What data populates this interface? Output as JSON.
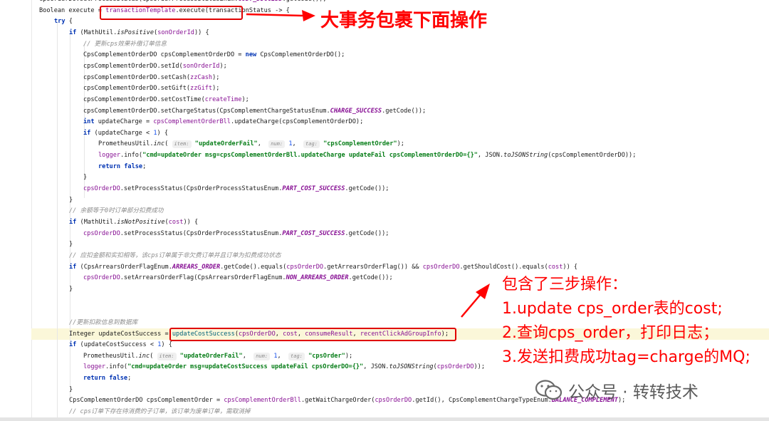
{
  "editor": {
    "lines": [
      {
        "indent": 0,
        "segments": [
          {
            "t": "cpsOrderDO.setProcessStatus(CpsOrderProcessStatusEnum."
          },
          {
            "t": "COST_SUCCESS",
            "c": "const"
          },
          {
            "t": ".getCode());"
          }
        ]
      },
      {
        "indent": 0,
        "segments": [
          {
            "t": "Boolean execute = "
          },
          {
            "t": "transactionTemplate",
            "c": "fld"
          },
          {
            "t": ".execute(transactionStatus -> {"
          }
        ]
      },
      {
        "indent": 1,
        "segments": [
          {
            "t": "try",
            "c": "kw"
          },
          {
            "t": " {"
          }
        ]
      },
      {
        "indent": 2,
        "segments": [
          {
            "t": "if",
            "c": "kw"
          },
          {
            "t": " (MathUtil."
          },
          {
            "t": "isPositive",
            "c": "ital"
          },
          {
            "t": "("
          },
          {
            "t": "sonOrderId",
            "c": "fld"
          },
          {
            "t": ")) {"
          }
        ]
      },
      {
        "indent": 3,
        "segments": [
          {
            "t": "// 更新cps效果补缴订单信息",
            "c": "cmt"
          }
        ]
      },
      {
        "indent": 3,
        "segments": [
          {
            "t": "CpsComplementOrderDO cpsComplementOrderDO = "
          },
          {
            "t": "new",
            "c": "kw"
          },
          {
            "t": " CpsComplementOrderDO();"
          }
        ]
      },
      {
        "indent": 3,
        "segments": [
          {
            "t": "cpsComplementOrderDO.setId("
          },
          {
            "t": "sonOrderId",
            "c": "fld"
          },
          {
            "t": ");"
          }
        ]
      },
      {
        "indent": 3,
        "segments": [
          {
            "t": "cpsComplementOrderDO.setCash("
          },
          {
            "t": "zzCash",
            "c": "fld"
          },
          {
            "t": ");"
          }
        ]
      },
      {
        "indent": 3,
        "segments": [
          {
            "t": "cpsComplementOrderDO.setGift("
          },
          {
            "t": "zzGift",
            "c": "fld"
          },
          {
            "t": ");"
          }
        ]
      },
      {
        "indent": 3,
        "segments": [
          {
            "t": "cpsComplementOrderDO.setCostTime("
          },
          {
            "t": "createTime",
            "c": "fld"
          },
          {
            "t": ");"
          }
        ]
      },
      {
        "indent": 3,
        "segments": [
          {
            "t": "cpsComplementOrderDO.setChargeStatus(CpsComplementChargeStatusEnum."
          },
          {
            "t": "CHARGE_SUCCESS",
            "c": "const"
          },
          {
            "t": ".getCode());"
          }
        ]
      },
      {
        "indent": 3,
        "segments": [
          {
            "t": "int",
            "c": "kw"
          },
          {
            "t": " updateCharge = "
          },
          {
            "t": "cpsComplementOrderBll",
            "c": "fld"
          },
          {
            "t": ".updateCharge(cpsComplementOrderDO);"
          }
        ]
      },
      {
        "indent": 3,
        "segments": [
          {
            "t": "if",
            "c": "kw"
          },
          {
            "t": " (updateCharge < "
          },
          {
            "t": "1",
            "c": "num"
          },
          {
            "t": ") {"
          }
        ]
      },
      {
        "indent": 4,
        "segments": [
          {
            "t": "PrometheusUtil."
          },
          {
            "t": "inc",
            "c": "ital"
          },
          {
            "t": "( "
          },
          {
            "t": "item:",
            "c": "hint"
          },
          {
            "t": " "
          },
          {
            "t": "\"updateOrderFail\"",
            "c": "str"
          },
          {
            "t": ",  "
          },
          {
            "t": "num:",
            "c": "hint"
          },
          {
            "t": " "
          },
          {
            "t": "1",
            "c": "num"
          },
          {
            "t": ",  "
          },
          {
            "t": "tag:",
            "c": "hint"
          },
          {
            "t": " "
          },
          {
            "t": "\"cpsComplementOrder\"",
            "c": "str"
          },
          {
            "t": ");"
          }
        ]
      },
      {
        "indent": 4,
        "segments": [
          {
            "t": "logger",
            "c": "fld"
          },
          {
            "t": ".info("
          },
          {
            "t": "\"cmd=updateOrder msg=cpsComplementOrderBll.updateCharge updateFail cpsComplementOrderDO={}\"",
            "c": "str"
          },
          {
            "t": ", JSON."
          },
          {
            "t": "toJSONString",
            "c": "ital"
          },
          {
            "t": "(cpsComplementOrderDO));"
          }
        ]
      },
      {
        "indent": 4,
        "segments": [
          {
            "t": "return false",
            "c": "kw"
          },
          {
            "t": ";"
          }
        ]
      },
      {
        "indent": 3,
        "segments": [
          {
            "t": "}"
          }
        ]
      },
      {
        "indent": 3,
        "segments": [
          {
            "t": "cpsOrderDO",
            "c": "fld"
          },
          {
            "t": ".setProcessStatus(CpsOrderProcessStatusEnum."
          },
          {
            "t": "PART_COST_SUCCESS",
            "c": "const"
          },
          {
            "t": ".getCode());"
          }
        ]
      },
      {
        "indent": 2,
        "segments": [
          {
            "t": "}"
          }
        ]
      },
      {
        "indent": 2,
        "segments": [
          {
            "t": "// 余额等于0时订单部分扣费成功",
            "c": "cmt"
          }
        ]
      },
      {
        "indent": 2,
        "segments": [
          {
            "t": "if",
            "c": "kw"
          },
          {
            "t": " (MathUtil."
          },
          {
            "t": "isNotPositive",
            "c": "ital"
          },
          {
            "t": "("
          },
          {
            "t": "cost",
            "c": "fld"
          },
          {
            "t": ")) {"
          }
        ]
      },
      {
        "indent": 3,
        "segments": [
          {
            "t": "cpsOrderDO",
            "c": "fld"
          },
          {
            "t": ".setProcessStatus(CpsOrderProcessStatusEnum."
          },
          {
            "t": "PART_COST_SUCCESS",
            "c": "const"
          },
          {
            "t": ".getCode());"
          }
        ]
      },
      {
        "indent": 2,
        "segments": [
          {
            "t": "}"
          }
        ]
      },
      {
        "indent": 2,
        "segments": [
          {
            "t": "// 应扣金额和实扣相等，该cps订单属于非欠费订单并且订单为扣费成功状态",
            "c": "cmt"
          }
        ]
      },
      {
        "indent": 2,
        "segments": [
          {
            "t": "if",
            "c": "kw"
          },
          {
            "t": " (CpsArrearsOrderFlagEnum."
          },
          {
            "t": "ARREARS_ORDER",
            "c": "const"
          },
          {
            "t": ".getCode().equals("
          },
          {
            "t": "cpsOrderDO",
            "c": "fld"
          },
          {
            "t": ".getArrearsOrderFlag()) && "
          },
          {
            "t": "cpsOrderDO",
            "c": "fld"
          },
          {
            "t": ".getShouldCost().equals("
          },
          {
            "t": "cost",
            "c": "fld"
          },
          {
            "t": ")) {"
          }
        ]
      },
      {
        "indent": 3,
        "segments": [
          {
            "t": "cpsOrderDO",
            "c": "fld"
          },
          {
            "t": ".setArrearsOrderFlag(CpsArrearsOrderFlagEnum."
          },
          {
            "t": "NON_ARREARS_ORDER",
            "c": "const"
          },
          {
            "t": ".getCode());"
          }
        ]
      },
      {
        "indent": 2,
        "segments": [
          {
            "t": "}"
          }
        ]
      },
      {
        "indent": 2,
        "segments": []
      },
      {
        "indent": 2,
        "segments": []
      },
      {
        "indent": 2,
        "segments": [
          {
            "t": "//更新扣款信息到数据库",
            "c": "cmt"
          }
        ]
      },
      {
        "indent": 2,
        "segments": [
          {
            "t": "Integer updateCostSuccess = "
          },
          {
            "t": "updateCostSuccess",
            "c": "fn"
          },
          {
            "t": "("
          },
          {
            "t": "cpsOrderDO",
            "c": "fld"
          },
          {
            "t": ", "
          },
          {
            "t": "cost",
            "c": "fld"
          },
          {
            "t": ", "
          },
          {
            "t": "consumeResult",
            "c": "fld"
          },
          {
            "t": ", "
          },
          {
            "t": "recentClickAdGroupInfo",
            "c": "fld"
          },
          {
            "t": ");"
          }
        ]
      },
      {
        "indent": 2,
        "segments": [
          {
            "t": "if",
            "c": "kw"
          },
          {
            "t": " (updateCostSuccess < "
          },
          {
            "t": "1",
            "c": "num"
          },
          {
            "t": ") {"
          }
        ]
      },
      {
        "indent": 3,
        "segments": [
          {
            "t": "PrometheusUtil."
          },
          {
            "t": "inc",
            "c": "ital"
          },
          {
            "t": "( "
          },
          {
            "t": "item:",
            "c": "hint"
          },
          {
            "t": " "
          },
          {
            "t": "\"updateOrderFail\"",
            "c": "str"
          },
          {
            "t": ",  "
          },
          {
            "t": "num:",
            "c": "hint"
          },
          {
            "t": " "
          },
          {
            "t": "1",
            "c": "num"
          },
          {
            "t": ",  "
          },
          {
            "t": "tag:",
            "c": "hint"
          },
          {
            "t": " "
          },
          {
            "t": "\"cpsOrder\"",
            "c": "str"
          },
          {
            "t": ");"
          }
        ]
      },
      {
        "indent": 3,
        "segments": [
          {
            "t": "logger",
            "c": "fld"
          },
          {
            "t": ".info("
          },
          {
            "t": "\"cmd=updateOrder msg=updateCostSuccess updateFail cpsOrderDO={}\"",
            "c": "str"
          },
          {
            "t": ", JSON."
          },
          {
            "t": "toJSONString",
            "c": "ital"
          },
          {
            "t": "("
          },
          {
            "t": "cpsOrderDO",
            "c": "fld"
          },
          {
            "t": "));"
          }
        ]
      },
      {
        "indent": 3,
        "segments": [
          {
            "t": "return false",
            "c": "kw"
          },
          {
            "t": ";"
          }
        ]
      },
      {
        "indent": 2,
        "segments": [
          {
            "t": "}"
          }
        ]
      },
      {
        "indent": 2,
        "segments": [
          {
            "t": "CpsComplementOrderDO cpsComplementOrder = "
          },
          {
            "t": "cpsComplementOrderBll",
            "c": "fld"
          },
          {
            "t": ".getWaitChargeOrder("
          },
          {
            "t": "cpsOrderDO",
            "c": "fld"
          },
          {
            "t": ".getId(), CpsComplementChargeTypeEnum."
          },
          {
            "t": "BALANCE_COMPLEMENT",
            "c": "const"
          },
          {
            "t": ");"
          }
        ]
      },
      {
        "indent": 2,
        "segments": [
          {
            "t": "// cps订单下存在待消费的子订单，该订单为废单订单，需取消掉",
            "c": "cmt"
          }
        ]
      }
    ]
  },
  "annotations": {
    "title": "大事务包裹下面操作",
    "steps_heading": "包含了三步操作：",
    "steps": [
      "1.update cps_order表的cost;",
      "2.查询cps_order，打印日志；",
      "3.发送扣费成功tag=charge的MQ;"
    ]
  },
  "watermark": {
    "text": "公众号 · 转转技术",
    "icon": "wechat-icon"
  },
  "colors": {
    "annotation": "#ff0000",
    "keyword": "#0033b3",
    "string": "#067d17",
    "field": "#871094"
  }
}
